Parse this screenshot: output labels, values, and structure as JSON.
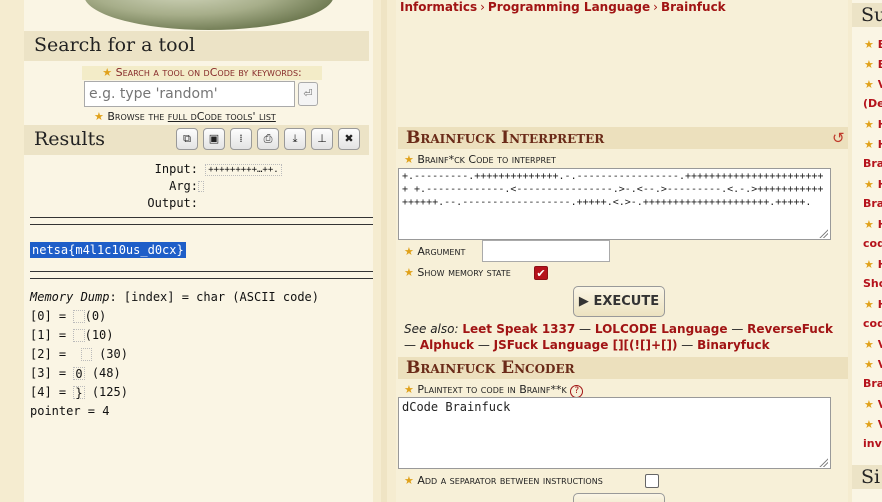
{
  "search_panel": {
    "title": "Search for a tool",
    "label": "Search a tool on dCode by keywords:",
    "placeholder": "e.g. type 'random'",
    "button_glyph": "⏎",
    "browse_prefix": "Browse the ",
    "browse_link": "full dCode tools' list"
  },
  "results_panel": {
    "title": "Results",
    "toolbar": [
      "copy",
      "screenshot",
      "split",
      "print",
      "download",
      "pin",
      "close"
    ],
    "input_label": "Input:",
    "input_value": "+++++++++…++.",
    "arg_label": "Arg:",
    "output_label": "Output:",
    "flag": "netsa{m4l1c10us_d0cx}",
    "memory_dump_label": "Memory Dump",
    "memory_dump_desc": ": [index] = char (ASCII code)",
    "memory": [
      {
        "index": "[0] = ",
        "char": " ",
        "code": "(0)"
      },
      {
        "index": "[1] = ",
        "char": " ",
        "code": "(10)"
      },
      {
        "index": "[2] = ",
        "char": " ",
        "code": "(30)"
      },
      {
        "index": "[3] = ",
        "char": "0",
        "code": "(48)"
      },
      {
        "index": "[4] = ",
        "char": "}",
        "code": "(125)"
      }
    ],
    "pointer": "pointer = 4"
  },
  "breadcrumb": [
    "Informatics",
    "Programming Language",
    "Brainfuck"
  ],
  "interpreter": {
    "title": "Brainfuck Interpreter",
    "code_label": "Brainf*ck Code to interpret",
    "code_value": "+.---------.++++++++++++++.-.-----------------.++++++++++++++++++++++++\n+.-------------.<----------------.>-.<--.>---------.<.-.>+++++++++++++++++.--.------------------.+++++.<.>-.+++++++++++++++++++++.+++++.",
    "argument_label": "Argument",
    "memory_label": "Show memory state",
    "memory_checked": true,
    "execute_label": "▶ EXECUTE",
    "see_also_prefix": "See also:",
    "see_also": [
      "Leet Speak 1337",
      "LOLCODE Language",
      "ReverseFuck",
      "Alphuck",
      "JSFuck Language [][(![]+[])",
      "Binaryfuck"
    ],
    "sep": " — "
  },
  "encoder": {
    "title": "Brainfuck Encoder",
    "plaintext_label": "Plaintext to code in Brainf**k",
    "help_glyph": "?",
    "plaintext_value": "dCode Brainfuck",
    "separator_label": "Add a separator between instructions"
  },
  "right_sidebar": {
    "heading1": "Su",
    "heading2": "Si",
    "items": [
      "B",
      "B",
      "V",
      "(De",
      "H",
      "H",
      "Bra",
      "H",
      "Bra",
      "H",
      "cod",
      "H",
      "Sho",
      "H",
      "cod",
      "V",
      "V",
      "Bra",
      "V",
      "V",
      "inve"
    ]
  },
  "colors": {
    "accent": "#a11414",
    "star": "#e0a11a",
    "flag_bg": "#1e5ec8"
  }
}
